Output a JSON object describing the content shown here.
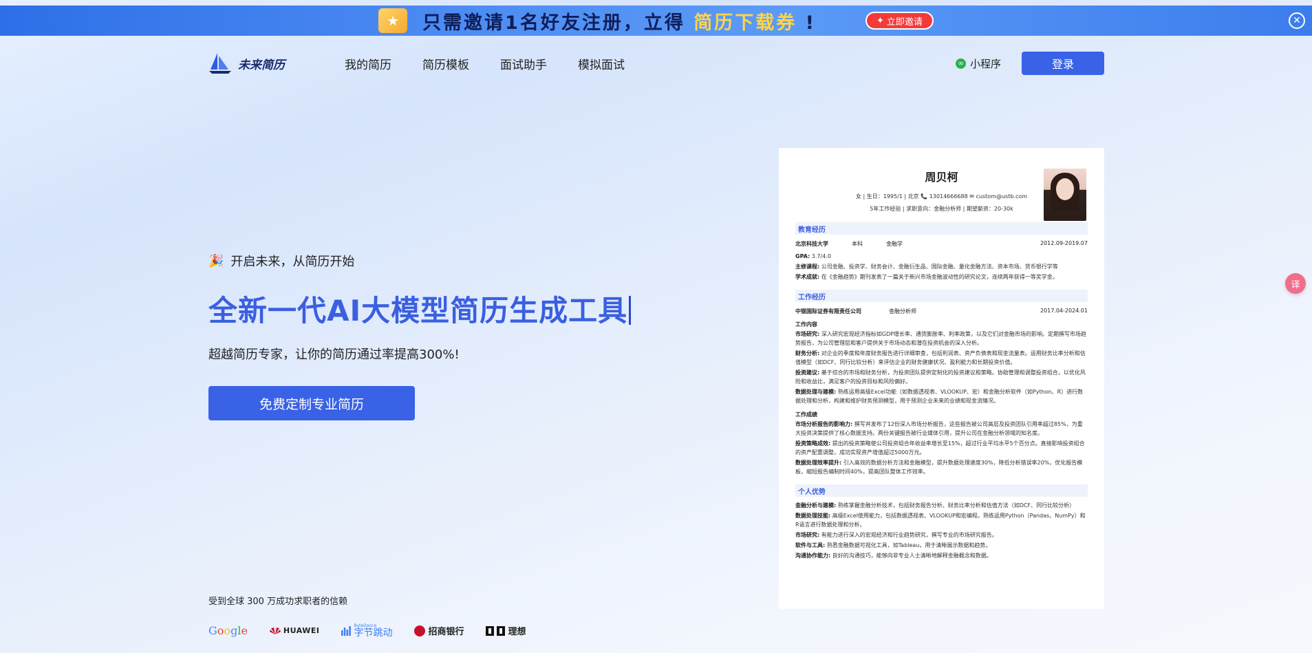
{
  "banner": {
    "text_part1": "只需邀请1名好友注册，立得",
    "text_highlight": "简历下载券",
    "text_part2": "!",
    "button_label": "立即邀请",
    "close_glyph": "✕"
  },
  "nav": {
    "logo_text": "未来简历",
    "menu": [
      "我的简历",
      "简历模板",
      "面试助手",
      "模拟面试"
    ],
    "mini_program": "小程序",
    "login": "登录"
  },
  "hero": {
    "kicker_icon": "🎉",
    "kicker": "开启未来，从简历开始",
    "title": "全新一代AI大模型简历生成工具",
    "subtitle": "超越简历专家，让你的简历通过率提高300%!",
    "cta": "免费定制专业简历"
  },
  "trust": {
    "text": "受到全球 300 万成功求职者的信赖",
    "partners": {
      "google": [
        "G",
        "o",
        "o",
        "g",
        "l",
        "e"
      ],
      "huawei": "HUAWEI",
      "bytedance_en": "ByteDance",
      "bytedance_cn": "字节跳动",
      "cmb": "招商银行",
      "lixiang": "理想"
    }
  },
  "float_button": "译",
  "resume": {
    "name": "周贝柯",
    "meta": "女 | 生日：1995/1 | 北京 📞 13014666688 ✉ custom@ustb.com",
    "meta2": "5年工作经验 | 求职意向：金融分析师 | 期望薪资：20-30k",
    "education": {
      "heading": "教育经历",
      "school": "北京科技大学",
      "degree": "本科",
      "major": "金融学",
      "period": "2012.09-2019.07",
      "gpa_label": "GPA:",
      "gpa": "3.7/4.0",
      "courses_label": "主修课程:",
      "courses": "公司金融、投资学、财务会计、金融衍生品、国际金融、量化金融方法、资本市场、货币银行学等",
      "academic_label": "学术成就:",
      "academic": "在《金融趋势》期刊发表了一篇关于新兴市场金融波动性的研究论文，连续两年获得一等奖学金。"
    },
    "work": {
      "heading": "工作经历",
      "company": "中银国际证券有限责任公司",
      "role": "金融分析师",
      "period": "2017.04-2024.01",
      "content_label": "工作内容",
      "items": [
        {
          "label": "市场研究:",
          "text": "深入研究宏观经济指标如GDP增长率、通货膨胀率、利率政策，以及它们对金融市场的影响。定期撰写市场趋势报告，为公司管理层和客户提供关于市场动态和潜在投资机会的深入分析。"
        },
        {
          "label": "财务分析:",
          "text": "对企业的季度和年度财务报告进行详细审查，包括利润表、资产负债表和现金流量表。运用财务比率分析和估值模型（如DCF、同行比较分析）来评估企业的财务健康状况、盈利能力和长期投资价值。"
        },
        {
          "label": "投资建议:",
          "text": "基于综合的市场和财务分析，为投资团队提供定制化的投资建议和策略。协助管理和调整投资组合，以优化风险和收益比，满足客户的投资目标和风险偏好。"
        },
        {
          "label": "数据处理与建模:",
          "text": "熟练运用高级Excel功能（如数据透视表、VLOOKUP、宏）和金融分析软件（如Python、R）进行数据处理和分析，构建和维护财务预测模型，用于预测企业未来的业绩和现金流情况。"
        }
      ],
      "results_label": "工作成绩",
      "results": [
        {
          "label": "市场分析报告的影响力:",
          "text": "撰写并发布了12份深入市场分析报告，这些报告被公司高层及投资团队引用率超过85%，为重大投资决策提供了核心数据支持。两份关键报告被行业媒体引用，提升公司在金融分析领域的知名度。"
        },
        {
          "label": "投资策略成效:",
          "text": "提出的投资策略使公司投资组合年收益率增长至15%，超过行业平均水平5个百分点。直接影响投资组合的资产配置调整，成功实现资产增值超过5000万元。"
        },
        {
          "label": "数据处理效率提升:",
          "text": "引入高效的数据分析方法和金融模型，提升数据处理速度30%，降低分析错误率20%，优化报告模板，缩短报告编制时间40%，提高团队整体工作效率。"
        }
      ]
    },
    "skills": {
      "heading": "个人优势",
      "items": [
        {
          "label": "金融分析与建模:",
          "text": "熟练掌握金融分析技术，包括财务报告分析、财务比率分析和估值方法（如DCF、同行比较分析）"
        },
        {
          "label": "数据处理技能:",
          "text": "高级Excel使用能力，包括数据透视表、VLOOKUP和宏编程。熟练运用Python（Pandas、NumPy）和R语言进行数据处理和分析。"
        },
        {
          "label": "市场研究:",
          "text": "有能力进行深入的宏观经济和行业趋势研究，撰写专业的市场研究报告。"
        },
        {
          "label": "软件与工具:",
          "text": "熟悉金融数据可视化工具，如Tableau，用于清晰展示数据和趋势。"
        },
        {
          "label": "沟通协作能力:",
          "text": "良好的沟通技巧，能够向非专业人士清晰地解释金融概念和数据。"
        }
      ]
    }
  }
}
